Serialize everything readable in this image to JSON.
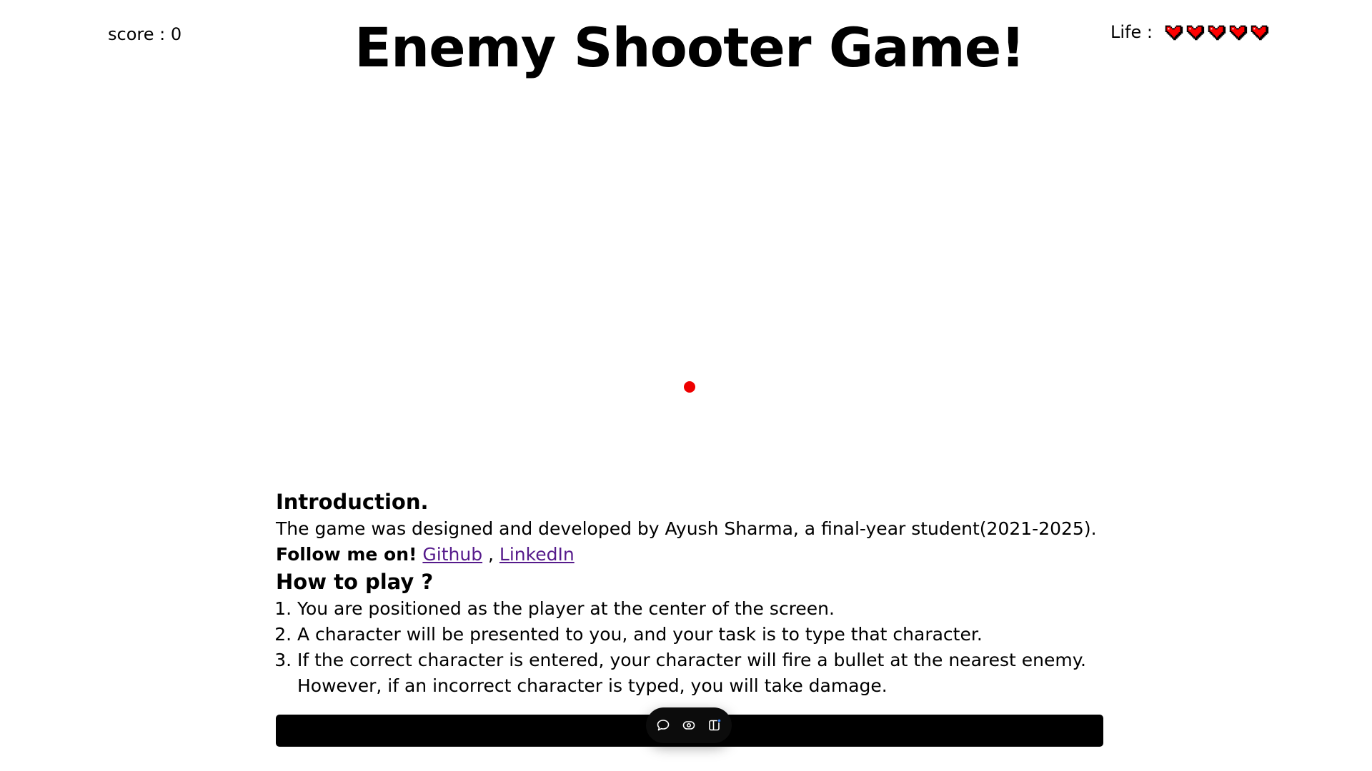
{
  "score": {
    "text": "score : 0"
  },
  "title": "Enemy Shooter Game!",
  "life": {
    "label": "Life :",
    "hearts_full": 5,
    "heart_color": "#ff0000"
  },
  "player": {
    "color": "#ee0000"
  },
  "intro": {
    "heading": "Introduction.",
    "text": "The game was designed and developed by Ayush Sharma, a final-year student(2021-2025).",
    "follow_label": "Follow me on!",
    "github_label": "Github",
    "separator": " , ",
    "linkedin_label": "LinkedIn"
  },
  "howto": {
    "heading": "How to play ?",
    "steps": [
      "You are positioned as the player at the center of the screen.",
      "A character will be presented to you, and your task is to type that character.",
      "If the correct character is entered, your character will fire a bullet at the nearest enemy. However, if an incorrect character is typed, you will take damage."
    ]
  },
  "toolbar": {
    "icons": [
      "comment-icon",
      "eye-icon",
      "sidebar-icon"
    ]
  }
}
